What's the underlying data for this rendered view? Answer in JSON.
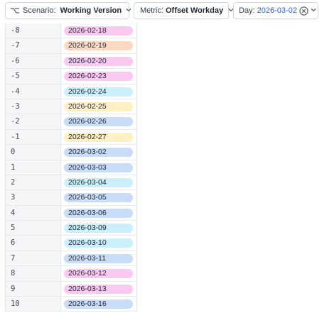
{
  "toolbar": {
    "scenario": {
      "label": "Scenario:",
      "value": "Working Version",
      "icon": "branch-icon",
      "swatch_color": "#1f4fd1"
    },
    "metric": {
      "label": "Metric:",
      "value": "Offset Workday"
    },
    "day": {
      "label": "Day:",
      "value": "2026-03-02"
    }
  },
  "colors": {
    "pink": "#f9c9f2",
    "orange": "#fcd9c3",
    "cyan": "#c9f0fb",
    "yellow": "#fdf0c4",
    "blue": "#c9dcf8"
  },
  "rows": [
    {
      "offset": "-8",
      "date": "2026-02-18",
      "color": "pink"
    },
    {
      "offset": "-7",
      "date": "2026-02-19",
      "color": "orange"
    },
    {
      "offset": "-6",
      "date": "2026-02-20",
      "color": "pink"
    },
    {
      "offset": "-5",
      "date": "2026-02-23",
      "color": "pink"
    },
    {
      "offset": "-4",
      "date": "2026-02-24",
      "color": "cyan"
    },
    {
      "offset": "-3",
      "date": "2026-02-25",
      "color": "yellow"
    },
    {
      "offset": "-2",
      "date": "2026-02-26",
      "color": "blue"
    },
    {
      "offset": "-1",
      "date": "2026-02-27",
      "color": "yellow"
    },
    {
      "offset": "0",
      "date": "2026-03-02",
      "color": "blue"
    },
    {
      "offset": "1",
      "date": "2026-03-03",
      "color": "blue"
    },
    {
      "offset": "2",
      "date": "2026-03-04",
      "color": "cyan"
    },
    {
      "offset": "3",
      "date": "2026-03-05",
      "color": "blue"
    },
    {
      "offset": "4",
      "date": "2026-03-06",
      "color": "blue"
    },
    {
      "offset": "5",
      "date": "2026-03-09",
      "color": "cyan"
    },
    {
      "offset": "6",
      "date": "2026-03-10",
      "color": "cyan"
    },
    {
      "offset": "7",
      "date": "2026-03-11",
      "color": "blue"
    },
    {
      "offset": "8",
      "date": "2026-03-12",
      "color": "pink"
    },
    {
      "offset": "9",
      "date": "2026-03-13",
      "color": "pink"
    },
    {
      "offset": "10",
      "date": "2026-03-16",
      "color": "blue"
    }
  ]
}
